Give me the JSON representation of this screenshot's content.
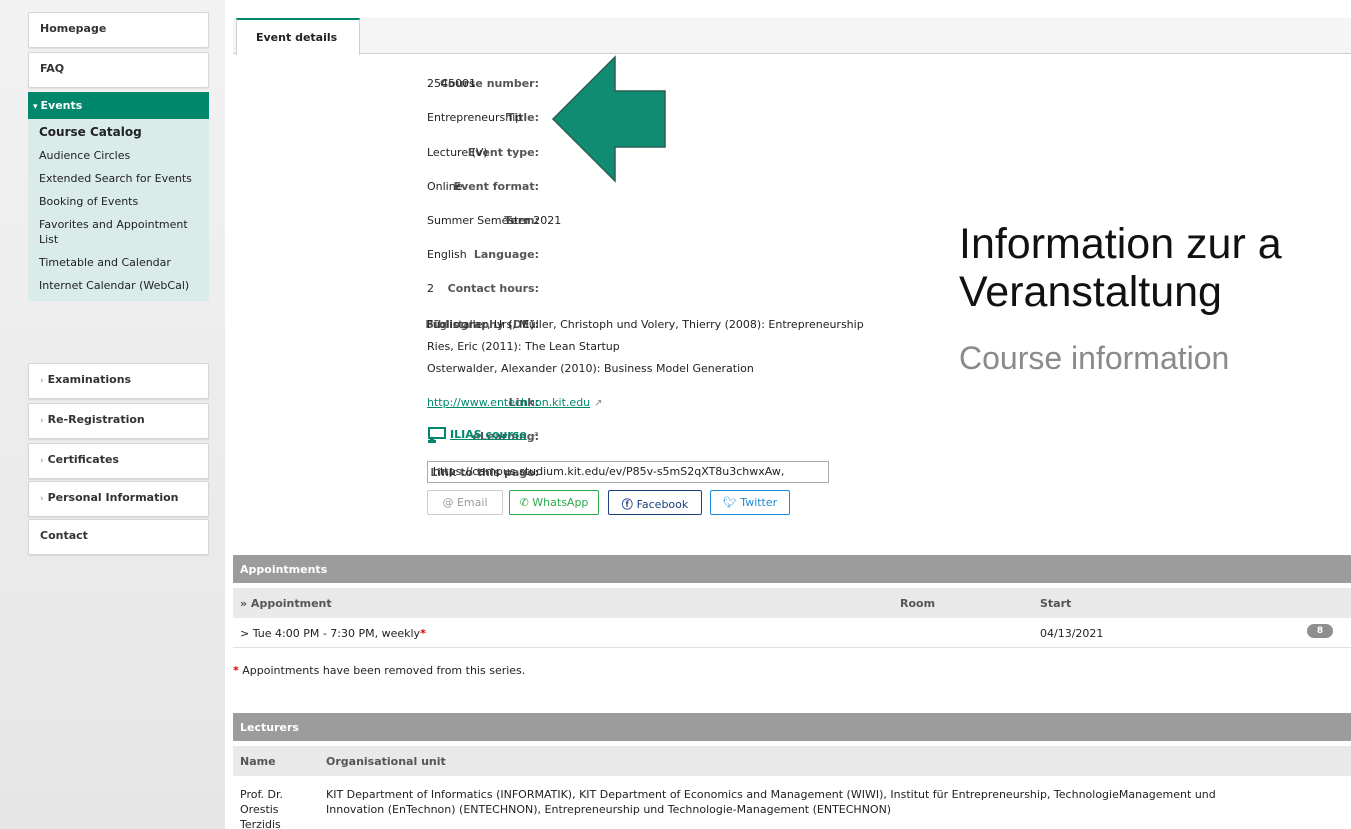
{
  "sidebar": {
    "homepage": "Homepage",
    "faq": "FAQ",
    "events": {
      "label": "Events",
      "items": [
        "Course Catalog",
        "Audience Circles",
        "Extended Search for Events",
        "Booking of Events",
        "Favorites and Appointment List",
        "Timetable and Calendar",
        "Internet Calendar (WebCal)"
      ]
    },
    "examinations": "Examinations",
    "reregistration": "Re-Registration",
    "certificates": "Certificates",
    "personal_information": "Personal Information",
    "contact": "Contact"
  },
  "tabs": {
    "event_details": "Event details"
  },
  "details": {
    "course_number": {
      "label": "Course number:",
      "value": "2545001"
    },
    "title": {
      "label": "Title:",
      "value": "Entrepreneurship"
    },
    "event_type": {
      "label": "Event type:",
      "value": "Lecture (V)"
    },
    "event_format": {
      "label": "Event format:",
      "value": "Online"
    },
    "term": {
      "label": "Term:",
      "value": "Summer Semester 2021"
    },
    "language": {
      "label": "Language:",
      "value": "English"
    },
    "contact_hours": {
      "label": "Contact hours:",
      "value": "2"
    },
    "bibliography": {
      "label": "Bibliography (DE):",
      "lines": [
        "Füglistaller, Urs, Müller, Christoph und Volery, Thierry (2008): Entrepreneurship",
        "Ries, Eric (2011): The Lean Startup",
        "Osterwalder, Alexander (2010): Business Model Generation"
      ]
    },
    "link": {
      "label": "Link:",
      "value": "http://www.entechnon.kit.edu"
    },
    "elearning": {
      "label": "eLearning:",
      "value": "ILIAS course"
    },
    "permalink": {
      "label": "Link to this page:",
      "value": "https://campus.studium.kit.edu/ev/P85v-s5mS2qXT8u3chwxAw,"
    }
  },
  "share": {
    "email": "Email",
    "whatsapp": "WhatsApp",
    "facebook": "Facebook",
    "twitter": "Twitter"
  },
  "overlay": {
    "heading_line1": "Information zur a",
    "heading_line2": "Veranstaltung",
    "subheading": "Course information"
  },
  "appointments": {
    "title": "Appointments",
    "columns": {
      "appointment": "» Appointment",
      "room": "Room",
      "start": "Start"
    },
    "rows": [
      {
        "appointment": "> Tue 4:00 PM - 7:30 PM, weekly",
        "marker": "*",
        "room": "",
        "start": "04/13/2021",
        "count": "8"
      }
    ],
    "footnote_marker": "*",
    "footnote": "Appointments have been removed from this series."
  },
  "lecturers": {
    "title": "Lecturers",
    "columns": {
      "name": "Name",
      "unit": "Organisational unit"
    },
    "rows": [
      {
        "name_lines": [
          "Prof. Dr.",
          "Orestis",
          "Terzidis"
        ],
        "unit_lines": [
          "KIT Department of Informatics (INFORMATIK), KIT Department of Economics and Management (WIWI), Institut für Entrepreneurship, TechnologieManagement und",
          "Innovation (EnTechnon) (ENTECHNON), Entrepreneurship und Technologie-Management (ENTECHNON)"
        ]
      }
    ]
  },
  "colors": {
    "accent": "#00876c",
    "arrow": "#0f8c72",
    "table_header": "#9c9c9c"
  }
}
